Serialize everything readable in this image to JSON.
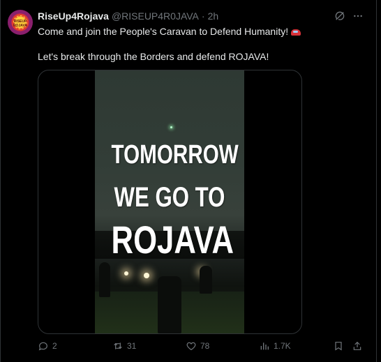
{
  "tweet": {
    "author_name": "RiseUp4Rojava",
    "handle": "@RISEUP4R0JAVA",
    "separator": "·",
    "time": "2h",
    "line1": "Come and join the People's Caravan to Defend Humanity!",
    "line2": "Let's break through the Borders and defend ROJAVA!",
    "avatar_text": "RISEUP ROJAVA"
  },
  "media": {
    "overlay_line1": "TOMORROW",
    "overlay_line2": "WE GO TO",
    "overlay_line3": "ROJAVA"
  },
  "actions": {
    "replies": "2",
    "reposts": "31",
    "likes": "78",
    "views": "1.7K"
  },
  "icons": {
    "grok": "grok-icon",
    "more": "more-icon",
    "reply": "reply-icon",
    "repost": "repost-icon",
    "like": "heart-icon",
    "views": "views-icon",
    "bookmark": "bookmark-icon",
    "share": "share-icon",
    "emoji": "car-emoji-icon"
  },
  "colors": {
    "background": "#000000",
    "text": "#e7e9ea",
    "muted": "#71767b",
    "border": "#2f3336"
  }
}
